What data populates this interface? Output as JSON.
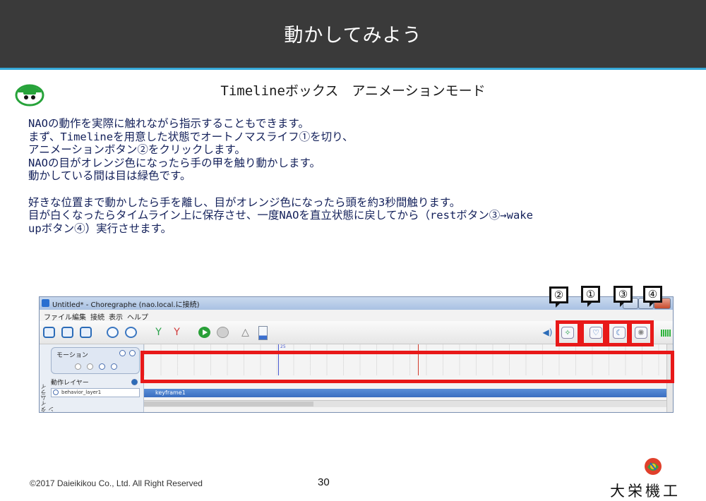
{
  "header": {
    "title": "動かしてみよう"
  },
  "subtitle": "Timelineボックス　アニメーションモード",
  "body": {
    "lines1": [
      "NAOの動作を実際に触れながら指示することもできます。",
      "まず、Timelineを用意した状態でオートノマスライフ①を切り、",
      "アニメーションボタン②をクリックします。",
      "NAOの目がオレンジ色になったら手の甲を触り動かします。",
      "動かしている間は目は緑色です。"
    ],
    "lines2": [
      "好きな位置まで動かしたら手を離し、目がオレンジ色になったら頭を約3秒間触ります。",
      "目が白くなったらタイムライン上に保存させ、一度NAOを直立状態に戻してから（restボタン③→wake",
      "upボタン④）実行させます。"
    ]
  },
  "screenshot": {
    "window_title": "Untitled* - Choregraphe (nao.local.に接続)",
    "menu": [
      "ファイル",
      "編集",
      "接続",
      "表示",
      "ヘルプ"
    ],
    "left_panel": {
      "vertical_label": "タイムライン",
      "motion_label": "モーション",
      "layer_label": "動作レイヤー",
      "layer_name": "behavior_layer1"
    },
    "timeline": {
      "frame_marker": "25",
      "keyframe_label": "keyframe1"
    }
  },
  "callouts": [
    "②",
    "①",
    "③",
    "④"
  ],
  "footer": {
    "copyright": "©2017 Daieikikou Co., Ltd. All Right Reserved",
    "page_number": "30",
    "company": "大栄機工"
  },
  "colors": {
    "header_bg": "#3a3a3a",
    "accent_line": "#35a8d8",
    "highlight_red": "#e81919",
    "text_navy": "#13205a"
  },
  "icons": [
    "robot-mascot-icon",
    "new-file-icon",
    "open-file-icon",
    "save-icon",
    "undo-icon",
    "redo-icon",
    "connect-icon",
    "disconnect-icon",
    "play-icon",
    "stop-icon",
    "warning-icon",
    "battery-icon",
    "volume-icon",
    "animation-mode-icon",
    "autonomous-life-icon",
    "rest-icon",
    "wakeup-icon",
    "company-logo-icon"
  ]
}
